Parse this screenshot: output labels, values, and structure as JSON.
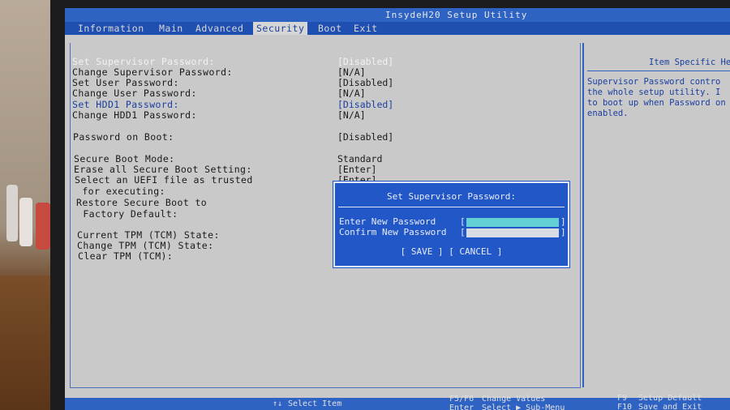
{
  "window": {
    "title": "InsydeH20 Setup Utility"
  },
  "menu": [
    "Information",
    "Main",
    "Advanced",
    "Security",
    "Boot",
    "Exit"
  ],
  "items": [
    {
      "label": "Set Supervisor Password:",
      "value": "[Disabled]"
    },
    {
      "label": "Change Supervisor Password:",
      "value": "[N/A]"
    },
    {
      "label": "Set User Password:",
      "value": "[Disabled]"
    },
    {
      "label": "Change User Password:",
      "value": "[N/A]"
    },
    {
      "label": "Set HDD1 Password:",
      "value": "[Disabled]"
    },
    {
      "label": "Change HDD1 Password:",
      "value": "[N/A]"
    },
    {
      "label": "Password on Boot:",
      "value": "[Disabled]"
    },
    {
      "label": "Secure Boot Mode:",
      "value": "Standard"
    },
    {
      "label": "Erase all Secure Boot Setting:",
      "value": "[Enter]"
    },
    {
      "label": "Select an UEFI file as trusted",
      "value": "[Enter]"
    },
    {
      "label": " for executing:",
      "value": ""
    },
    {
      "label": "Restore Secure Boot to",
      "value": ""
    },
    {
      "label": " Factory Default:",
      "value": ""
    },
    {
      "label": "Current TPM (TCM) State:",
      "value": ""
    },
    {
      "label": "Change TPM (TCM) State:",
      "value": ""
    },
    {
      "label": "Clear TPM (TCM):",
      "value": ""
    }
  ],
  "help": {
    "title": "Item Specific He",
    "text": "Supervisor Password contro\nthe whole setup utility. I\nto boot up when Password on\nenabled."
  },
  "dialog": {
    "title": "Set Supervisor Password:",
    "new_label": "Enter New Password",
    "confirm_label": "Confirm New Password",
    "bracket_open": "[",
    "bracket_close": "]",
    "save": "[ SAVE ]",
    "cancel": "[ CANCEL ]"
  },
  "status": {
    "arrows": "↑↓",
    "select_item": "Select Item",
    "f5f6": "F5/F6",
    "change_values": "Change Values",
    "enter": "Enter",
    "select_submenu": "Select ▶ Sub-Menu",
    "f9": "F9",
    "setup_default": "Setup Default",
    "f10": "F10",
    "save_exit": "Save and Exit"
  },
  "colors": {
    "bios_blue": "#2e63c4",
    "screen_gray": "#c9c9c9",
    "dialog_blue": "#2257c8",
    "cursor_cyan": "#62cfd3"
  }
}
